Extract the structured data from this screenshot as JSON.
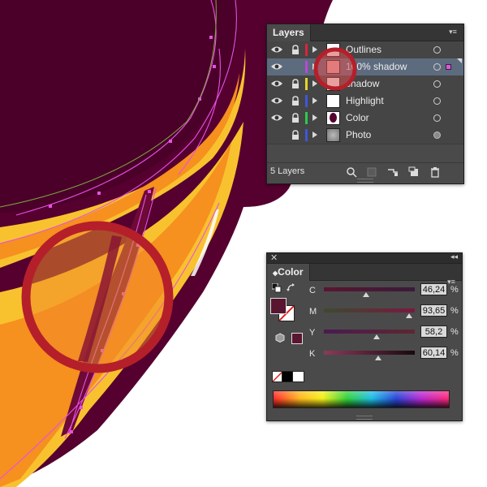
{
  "layers_panel": {
    "tab_title": "Layers",
    "layer_count_label": "5 Layers",
    "layers": [
      {
        "name": "Outlines",
        "color": "#d7263d",
        "visible": true,
        "locked": true,
        "selected": false
      },
      {
        "name": "100% shadow",
        "color": "#b848d8",
        "visible": true,
        "locked": false,
        "selected": true
      },
      {
        "name": "shadow",
        "color": "#e6d32a",
        "visible": true,
        "locked": true,
        "selected": false
      },
      {
        "name": "Highlight",
        "color": "#3f57d8",
        "visible": true,
        "locked": true,
        "selected": false
      },
      {
        "name": "Color",
        "color": "#2ec84c",
        "visible": true,
        "locked": true,
        "selected": false
      },
      {
        "name": "Photo",
        "color": "#3f57d8",
        "visible": false,
        "locked": true,
        "selected": false
      }
    ],
    "footer_icons": [
      "locate-object-icon",
      "make-clipping-mask-icon",
      "create-sublayer-icon",
      "create-new-layer-icon",
      "trash-icon"
    ]
  },
  "color_panel": {
    "tab_title": "Color",
    "fill_color": "#5a1530",
    "channels": [
      {
        "label": "C",
        "value": "46,24",
        "fraction": 0.4624
      },
      {
        "label": "M",
        "value": "93,65",
        "fraction": 0.9365
      },
      {
        "label": "Y",
        "value": "58,2",
        "fraction": 0.582
      },
      {
        "label": "K",
        "value": "60,14",
        "fraction": 0.6014
      }
    ],
    "percent_sign": "%"
  },
  "artwork": {
    "background_color": "#55002f",
    "stripe_orange": "#f6901e",
    "stripe_yellow": "#f8c22e",
    "path_color": "#e84fe8",
    "highlight_circle_color": "#b51f2a"
  }
}
